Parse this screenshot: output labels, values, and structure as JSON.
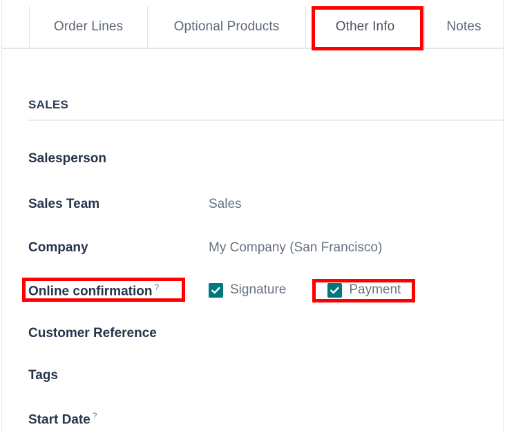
{
  "window": {
    "accent_teal": "#00787e",
    "annotation_color": "#fe0000",
    "label_color": "#26354c",
    "value_color": "#67727f"
  },
  "tabs": {
    "items": [
      {
        "label": "Order Lines",
        "active": false
      },
      {
        "label": "Optional Products",
        "active": false
      },
      {
        "label": "Other Info",
        "active": true
      },
      {
        "label": "Notes",
        "active": false
      }
    ]
  },
  "section": {
    "title": "SALES"
  },
  "fields": {
    "salesperson": {
      "label": "Salesperson",
      "value": ""
    },
    "sales_team": {
      "label": "Sales Team",
      "value": "Sales"
    },
    "company": {
      "label": "Company",
      "value": "My Company (San Francisco)"
    },
    "online_confirmation": {
      "label": "Online confirmation",
      "help": "?",
      "options": [
        {
          "label": "Signature",
          "checked": true
        },
        {
          "label": "Payment",
          "checked": true
        }
      ]
    },
    "customer_reference": {
      "label": "Customer Reference",
      "value": ""
    },
    "tags": {
      "label": "Tags",
      "value": ""
    },
    "start_date": {
      "label": "Start Date",
      "help": "?",
      "value": ""
    }
  },
  "annotations": {
    "highlighted": [
      "Other Info",
      "Online confirmation",
      "Payment"
    ]
  }
}
